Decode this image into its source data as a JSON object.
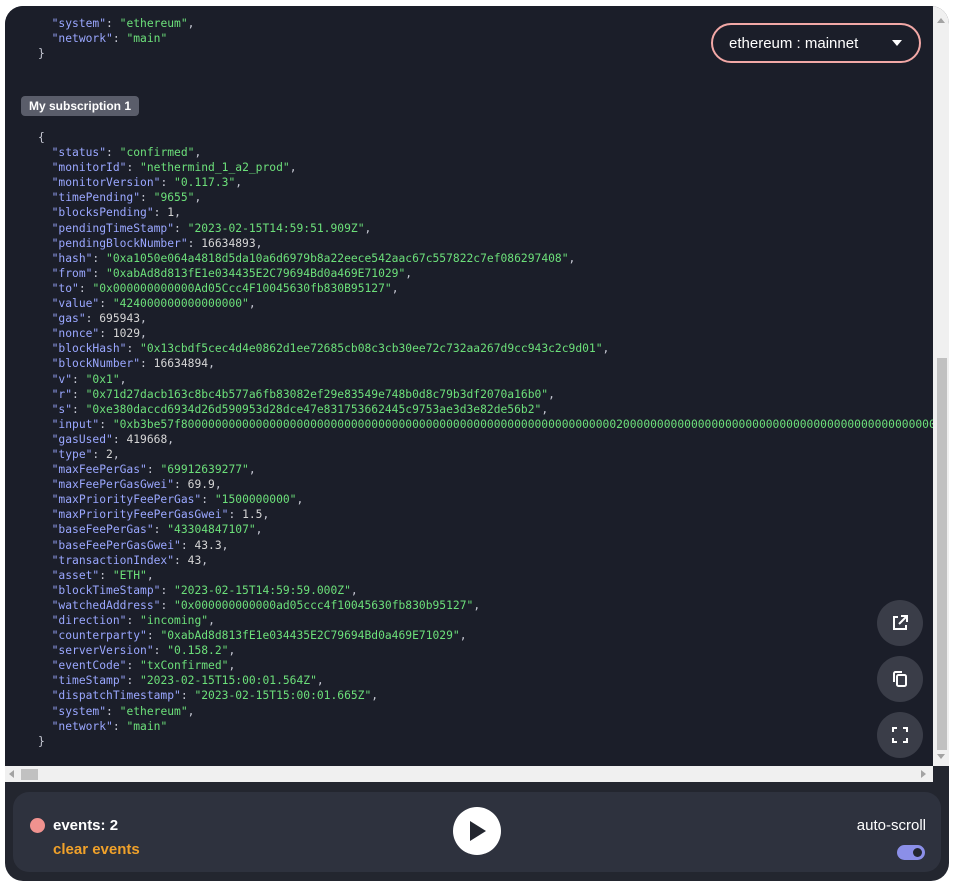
{
  "network_selector": {
    "label": "ethereum : mainnet"
  },
  "top_partial": [
    {
      "key": "system",
      "value": "ethereum",
      "kind": "string"
    },
    {
      "key": "network",
      "value": "main",
      "kind": "string",
      "last": true
    }
  ],
  "subscription": {
    "label": "My subscription 1",
    "event": [
      {
        "key": "status",
        "value": "confirmed",
        "kind": "string"
      },
      {
        "key": "monitorId",
        "value": "nethermind_1_a2_prod",
        "kind": "string"
      },
      {
        "key": "monitorVersion",
        "value": "0.117.3",
        "kind": "string"
      },
      {
        "key": "timePending",
        "value": "9655",
        "kind": "string"
      },
      {
        "key": "blocksPending",
        "value": "1",
        "kind": "number"
      },
      {
        "key": "pendingTimeStamp",
        "value": "2023-02-15T14:59:51.909Z",
        "kind": "string"
      },
      {
        "key": "pendingBlockNumber",
        "value": "16634893",
        "kind": "number"
      },
      {
        "key": "hash",
        "value": "0xa1050e064a4818d5da10a6d6979b8a22eece542aac67c557822c7ef086297408",
        "kind": "string"
      },
      {
        "key": "from",
        "value": "0xabAd8d813fE1e034435E2C79694Bd0a469E71029",
        "kind": "string"
      },
      {
        "key": "to",
        "value": "0x000000000000Ad05Ccc4F10045630fb830B95127",
        "kind": "string"
      },
      {
        "key": "value",
        "value": "424000000000000000",
        "kind": "string"
      },
      {
        "key": "gas",
        "value": "695943",
        "kind": "number"
      },
      {
        "key": "nonce",
        "value": "1029",
        "kind": "number"
      },
      {
        "key": "blockHash",
        "value": "0x13cbdf5cec4d4e0862d1ee72685cb08c3cb30ee72c732aa267d9cc943c2c9d01",
        "kind": "string"
      },
      {
        "key": "blockNumber",
        "value": "16634894",
        "kind": "number"
      },
      {
        "key": "v",
        "value": "0x1",
        "kind": "string"
      },
      {
        "key": "r",
        "value": "0x71d27dacb163c8bc4b577a6fb83082ef29e83549e748b0d8c79b3df2070a16b0",
        "kind": "string"
      },
      {
        "key": "s",
        "value": "0xe380daccd6934d26d590953d28dce47e831753662445c9753ae3d3e82de56b2",
        "kind": "string"
      },
      {
        "key": "input",
        "value": "0xb3be57f8000000000000000000000000000000000000000000000000000000000000000200000000000000000000000000000000000000000000000000000000",
        "kind": "string"
      },
      {
        "key": "gasUsed",
        "value": "419668",
        "kind": "number"
      },
      {
        "key": "type",
        "value": "2",
        "kind": "number"
      },
      {
        "key": "maxFeePerGas",
        "value": "69912639277",
        "kind": "string"
      },
      {
        "key": "maxFeePerGasGwei",
        "value": "69.9",
        "kind": "number"
      },
      {
        "key": "maxPriorityFeePerGas",
        "value": "1500000000",
        "kind": "string"
      },
      {
        "key": "maxPriorityFeePerGasGwei",
        "value": "1.5",
        "kind": "number"
      },
      {
        "key": "baseFeePerGas",
        "value": "43304847107",
        "kind": "string"
      },
      {
        "key": "baseFeePerGasGwei",
        "value": "43.3",
        "kind": "number"
      },
      {
        "key": "transactionIndex",
        "value": "43",
        "kind": "number"
      },
      {
        "key": "asset",
        "value": "ETH",
        "kind": "string"
      },
      {
        "key": "blockTimeStamp",
        "value": "2023-02-15T14:59:59.000Z",
        "kind": "string"
      },
      {
        "key": "watchedAddress",
        "value": "0x000000000000ad05ccc4f10045630fb830b95127",
        "kind": "string"
      },
      {
        "key": "direction",
        "value": "incoming",
        "kind": "string"
      },
      {
        "key": "counterparty",
        "value": "0xabAd8d813fE1e034435E2C79694Bd0a469E71029",
        "kind": "string"
      },
      {
        "key": "serverVersion",
        "value": "0.158.2",
        "kind": "string"
      },
      {
        "key": "eventCode",
        "value": "txConfirmed",
        "kind": "string"
      },
      {
        "key": "timeStamp",
        "value": "2023-02-15T15:00:01.564Z",
        "kind": "string"
      },
      {
        "key": "dispatchTimestamp",
        "value": "2023-02-15T15:00:01.665Z",
        "kind": "string"
      },
      {
        "key": "system",
        "value": "ethereum",
        "kind": "string"
      },
      {
        "key": "network",
        "value": "main",
        "kind": "string",
        "last": true
      }
    ]
  },
  "actions": {
    "open_external": "external-link-icon",
    "copy": "copy-icon",
    "fullscreen": "fullscreen-icon"
  },
  "controls": {
    "events_label": "events: 2",
    "clear_label": "clear events",
    "autoscroll_label": "auto-scroll",
    "autoscroll_on": true
  },
  "colors": {
    "accent_pink": "#f2a8a6",
    "status_dot": "#f0928f",
    "clear_orange": "#f0a12a",
    "json_key": "#9aa7ff",
    "json_string": "#6ce07a",
    "toggle_on": "#8b8fe8"
  }
}
